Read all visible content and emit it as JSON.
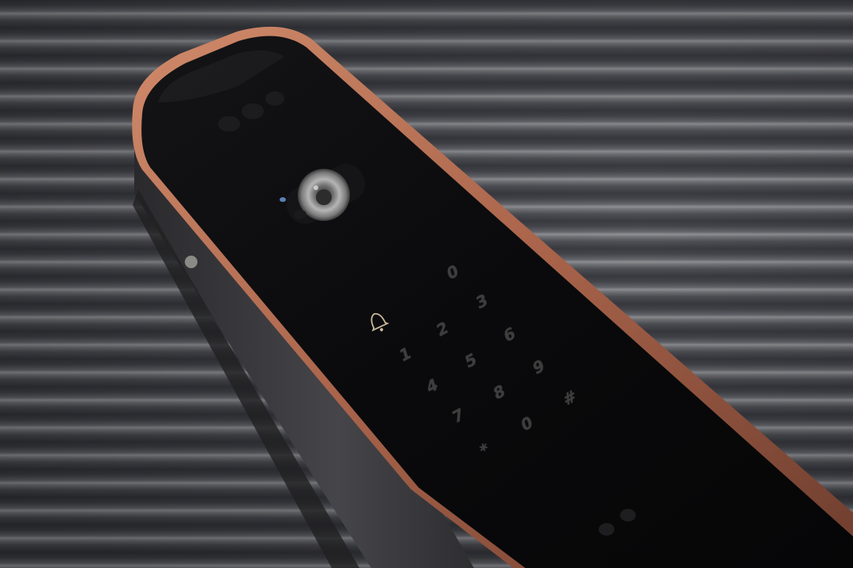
{
  "scene": {
    "subject": "smart-door-lock",
    "colors": {
      "background_stripes": "#5d5e64",
      "lock_glass": "#0c0c0e",
      "rose_gold_trim": "#b8745a",
      "side_body": "#3a3a3d",
      "key_glyph": "#3d3d3d",
      "bell_glyph": "#c9b89a"
    }
  },
  "keypad": {
    "bell_icon": "bell-icon",
    "keys": [
      "0",
      "3",
      "2",
      "6",
      "1",
      "5",
      "9",
      "4",
      "8",
      "#",
      "7",
      "0",
      "*"
    ]
  }
}
